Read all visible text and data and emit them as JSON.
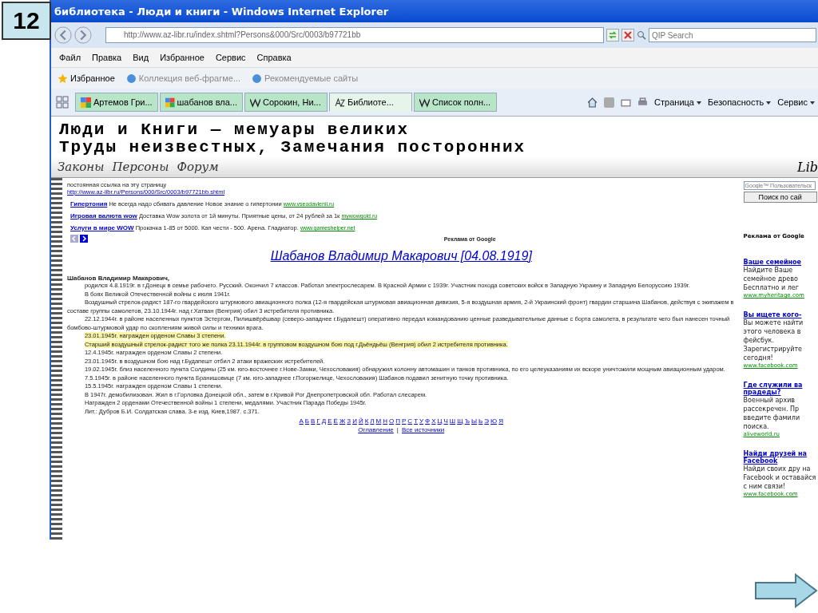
{
  "slide": {
    "number": "12"
  },
  "window": {
    "title": "библиотека - Люди и книги - Windows Internet Explorer"
  },
  "address_bar": {
    "value": "http://www.az-libr.ru/index.shtml?Persons&000/Src/0003/b97721bb",
    "search_placeholder": "QIP Search"
  },
  "menu": [
    "Файл",
    "Правка",
    "Вид",
    "Избранное",
    "Сервис",
    "Справка"
  ],
  "favorites_bar": {
    "label": "Избранное",
    "items": [
      "Коллекция веб-фрагме...",
      "Рекомендуемые сайты"
    ]
  },
  "tabs": [
    {
      "label": "Артемов Гри...",
      "kind": "google",
      "selected": false
    },
    {
      "label": "шабанов вла...",
      "kind": "google",
      "selected": false
    },
    {
      "label": "Сорокин, Ни...",
      "kind": "wiki",
      "selected": false
    },
    {
      "label": "Библиоте...",
      "kind": "az",
      "selected": true
    },
    {
      "label": "Список полн...",
      "kind": "wiki",
      "selected": false
    }
  ],
  "command_bar": [
    "Страница",
    "Безопасность",
    "Сервис"
  ],
  "site_header": {
    "line_1": "Люди и Книги — мемуары великих",
    "line_2": "Труды неизвестных, Замечания посторонних",
    "nav": [
      "Законы",
      "Персоны",
      "Форум"
    ],
    "logo": "Lib"
  },
  "permalink": {
    "label": "постоянная ссылка на эту страницу",
    "url": "http://www.az-libr.ru/Persons/000/Src/0003/b97721bb.shtml"
  },
  "ads": [
    {
      "title": "Гипертония",
      "text": "Не всегда надо сбивать давление Новое знание о гипертонии",
      "url": "www.vseodavlenii.ru"
    },
    {
      "title": "Игровая валюта wow",
      "text": "Доставка Wow золота от 1й минуты. Приятные цены, от 24 рублей за 1к",
      "url": "mywowgold.ru"
    },
    {
      "title": "Услуги в мире WOW",
      "text": "Прокачка 1-85 от 5000. Кап чести - 500. Арена. Гладиатор.",
      "url": "www.gameshelper.net"
    }
  ],
  "ads_label": "Реклама от Google",
  "article": {
    "heading": "Шабанов Владимир Макарович [04.08.1919]",
    "name": "Шабанов Владимир Макарович,",
    "paragraphs": [
      {
        "text": "родился 4.8.1919г. в г.Донецк в семье рабочего. Русский. Окончил 7 классов. Работал электрослесарем. В Красной Армии с 1939г. Участник похода советских войск в Западную Украину и Западную Белоруссию 1939г.",
        "highlighted": false
      },
      {
        "text": "В боях Великой Отечественной войны с июля 1941г.",
        "highlighted": false
      },
      {
        "text": "Воздушный стрелок-радист 187-го гвардейского штурмового авиационного полка (12-я гвардейская штурмовая авиационная дивизия, 5-я воздушная армия, 2-й Украинский фронт) гвардии старшина Шабанов, действуя с экипажем в составе группы самолетов, 23.10.1944г. над г.Хатван (Венгрия) обил 3 истребителя противника.",
        "highlighted": false
      },
      {
        "text": "22.12.1944г. в районе населенных пунктов Эстергом, Пилишвёрёшвар (северо-западнее г.Будапешт) оперативно передал командованию ценные разведывательные данные с борта самолета, в результате чего был нанесен точный бомбово-штурмовой удар по скоплениям живой силы и техники врага.",
        "highlighted": false
      },
      {
        "text": "23.01.1945г. награжден орденом Славы 3 степени.",
        "highlighted": true
      },
      {
        "text": "Старший воздушный стрелок-радист того же полка 23.11.1944г. в групповом воздушном бою под г.Дьёндьёш (Венгрия) обил 2 истребителя противника.",
        "highlighted": true
      },
      {
        "text": "12.4.1945г. награжден орденом Славы 2 степени.",
        "highlighted": false
      },
      {
        "text": "23.01.1945г. в воздушном бою над г.Будапешт отбил 2 атаки вражеских истребителей.",
        "highlighted": false
      },
      {
        "text": "19.02.1945г. близ населенного пункта Солдины (25 км. юго-восточнее г.Нове-Замки, Чехословакия) обнаружил колонну автомашин и танков противника, по его целеуказаниям их вскоре уничтожили мощным авиационным ударом.",
        "highlighted": false
      },
      {
        "text": "7.5.1945г. в районе населенного пункта Бранишовице (7 км. юго-западнее г.Погоржелице, Чехословакия) Шабанов подавил зенитную точку противника.",
        "highlighted": false
      },
      {
        "text": "15.5.1945г. награжден орденом Славы 1 степени.",
        "highlighted": false
      },
      {
        "text": "В 1947г. демобилизован. Жил в г.Горловка Донецкой обл., затем в г.Кривой Рог Днепропетровской обл. Работал слесарем.",
        "highlighted": false
      },
      {
        "text": "Награжден 2 орденами Отечественной войны 1 степени, медалями. Участник Парада Победы 1945г.",
        "highlighted": false
      },
      {
        "text": "Лит.: Дубров Б.И. Солдатская слава. 3-е изд. Киев,1987. с.371.",
        "highlighted": false
      }
    ]
  },
  "alphabet": [
    "А",
    "Б",
    "В",
    "Г",
    "Д",
    "Е",
    "Ё",
    "Ж",
    "З",
    "И",
    "Й",
    "К",
    "Л",
    "М",
    "Н",
    "О",
    "П",
    "Р",
    "С",
    "Т",
    "У",
    "Ф",
    "Х",
    "Ц",
    "Ч",
    "Ш",
    "Щ",
    "Ъ",
    "Ы",
    "Ь",
    "Э",
    "Ю",
    "Я"
  ],
  "footer_links": [
    "Оглавление",
    "Все источники"
  ],
  "footer_separator": "|",
  "sidebar": {
    "search_placeholder": "Google™ Пользовательск",
    "search_button": "Поиск по сай",
    "ads_label": "Реклама от Google",
    "ads": [
      {
        "title": "Ваше семейное",
        "text": "Найдите Ваше семейное древо Бесплатно и лег",
        "url": "www.myheritage.com"
      },
      {
        "title": "Вы ищете кого-",
        "text": "Вы можете найти этого человека в фейсбук. Зарегистрируйте сегодня!",
        "url": "www.facebook.com"
      },
      {
        "title": "Где служили ва прадеды?",
        "text": "Военный архив рассекречен. Пр введите фамили поиска.",
        "url": "aliveworld.ru"
      },
      {
        "title": "Найди друзей на Facebook",
        "text": "Найди своих дру на Facebook и оставайся с ним связи!",
        "url": "www.facebook.com"
      }
    ]
  }
}
